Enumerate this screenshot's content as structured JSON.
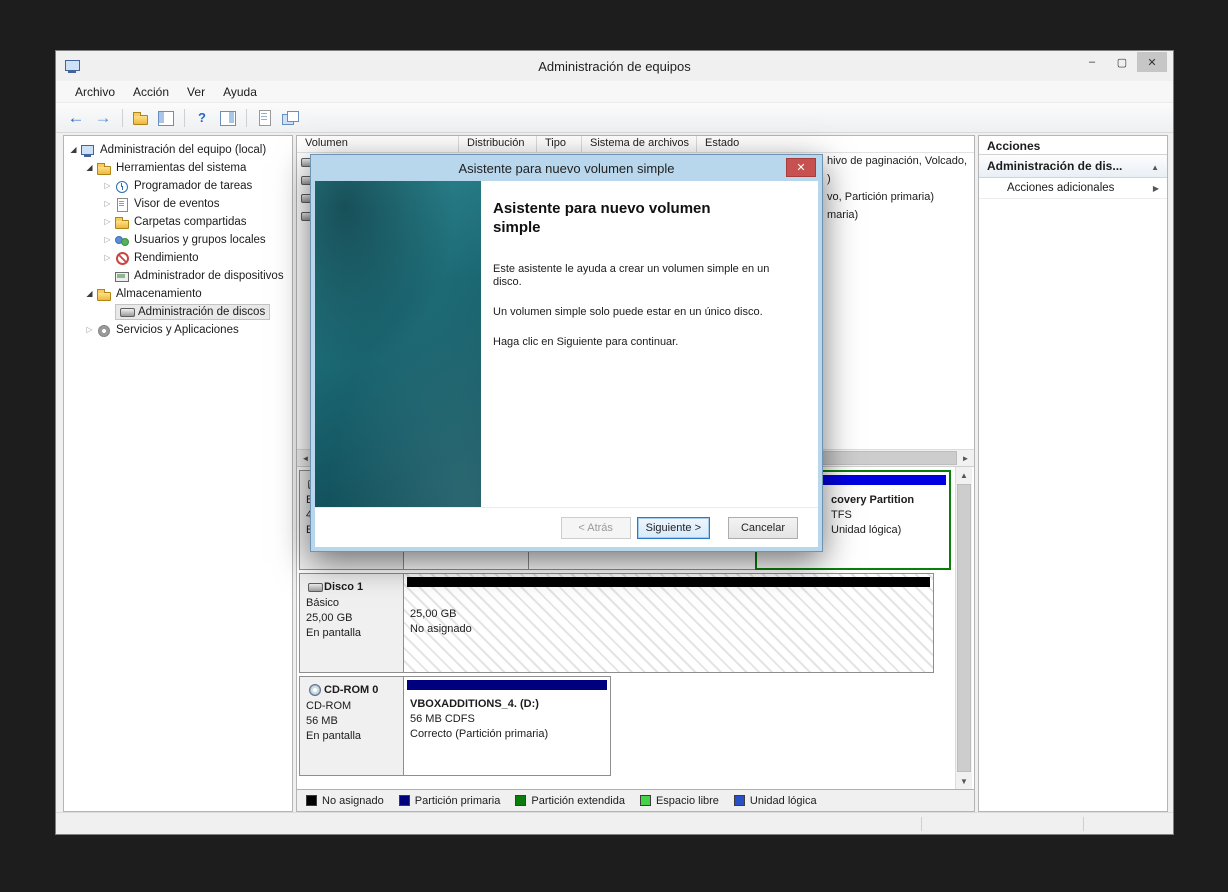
{
  "window": {
    "title": "Administración de equipos",
    "controls": {
      "minimize": "–",
      "maximize": "▢",
      "close": "✕"
    }
  },
  "menubar": {
    "items": [
      "Archivo",
      "Acción",
      "Ver",
      "Ayuda"
    ]
  },
  "toolbar": {
    "icons": [
      "back",
      "forward",
      "up-folder",
      "console-tree",
      "help",
      "action-pane",
      "export-list",
      "snap-ins"
    ]
  },
  "tree": {
    "items": [
      {
        "label": "Administración del equipo (local)"
      },
      {
        "label": "Herramientas del sistema"
      },
      {
        "label": "Programador de tareas"
      },
      {
        "label": "Visor de eventos"
      },
      {
        "label": "Carpetas compartidas"
      },
      {
        "label": "Usuarios y grupos locales"
      },
      {
        "label": "Rendimiento"
      },
      {
        "label": "Administrador de dispositivos"
      },
      {
        "label": "Almacenamiento"
      },
      {
        "label": "Administración de discos"
      },
      {
        "label": "Servicios y Aplicaciones"
      }
    ]
  },
  "volume_list": {
    "columns": [
      "Volumen",
      "Distribución",
      "Tipo",
      "Sistema de archivos",
      "Estado"
    ],
    "row_fragments": [
      "hivo de paginación, Volcado,",
      ")",
      "vo, Partición primaria)",
      "maria)"
    ]
  },
  "actions": {
    "header": "Acciones",
    "group": "Administración de dis...",
    "more": "Acciones adicionales"
  },
  "wizard": {
    "title": "Asistente para nuevo volumen simple",
    "heading": "Asistente para nuevo volumen simple",
    "p1": "Este asistente le ayuda a crear un volumen simple en un disco.",
    "p2": "Un volumen simple solo puede estar en un único disco.",
    "p3": "Haga clic en Siguiente para continuar.",
    "back_label": "< Atrás",
    "next_label": "Siguiente >",
    "cancel_label": "Cancelar"
  },
  "disks": {
    "disk0": {
      "label_line1": "B",
      "label_line2": "4",
      "label_line3": "E",
      "part_name": "covery Partition",
      "part_fs": "TFS",
      "part_status": "Unidad lógica)"
    },
    "disk1": {
      "name": "Disco 1",
      "type": "Básico",
      "size": "25,00 GB",
      "screen": "En pantalla",
      "part_size": "25,00 GB",
      "part_label": "No asignado"
    },
    "cdrom": {
      "name": "CD-ROM 0",
      "type": "CD-ROM",
      "size": "56 MB",
      "screen": "En pantalla",
      "part_name": "VBOXADDITIONS_4. (D:)",
      "part_fs": "56 MB CDFS",
      "part_status": "Correcto (Partición primaria)"
    }
  },
  "legend": {
    "items": [
      {
        "label": "No asignado",
        "color": "#000000"
      },
      {
        "label": "Partición primaria",
        "color": "#00007f"
      },
      {
        "label": "Partición extendida",
        "color": "#0b7d0b"
      },
      {
        "label": "Espacio libre",
        "color": "#46d246"
      },
      {
        "label": "Unidad lógica",
        "color": "#2a50c8"
      }
    ]
  },
  "colors": {
    "unallocated_band": "#000000",
    "primary_band": "#00007f",
    "logical_band": "#0000e0",
    "extended_border": "#0b7d0b",
    "dialog_accent": "#b9d7ec",
    "close_button": "#c75050"
  }
}
